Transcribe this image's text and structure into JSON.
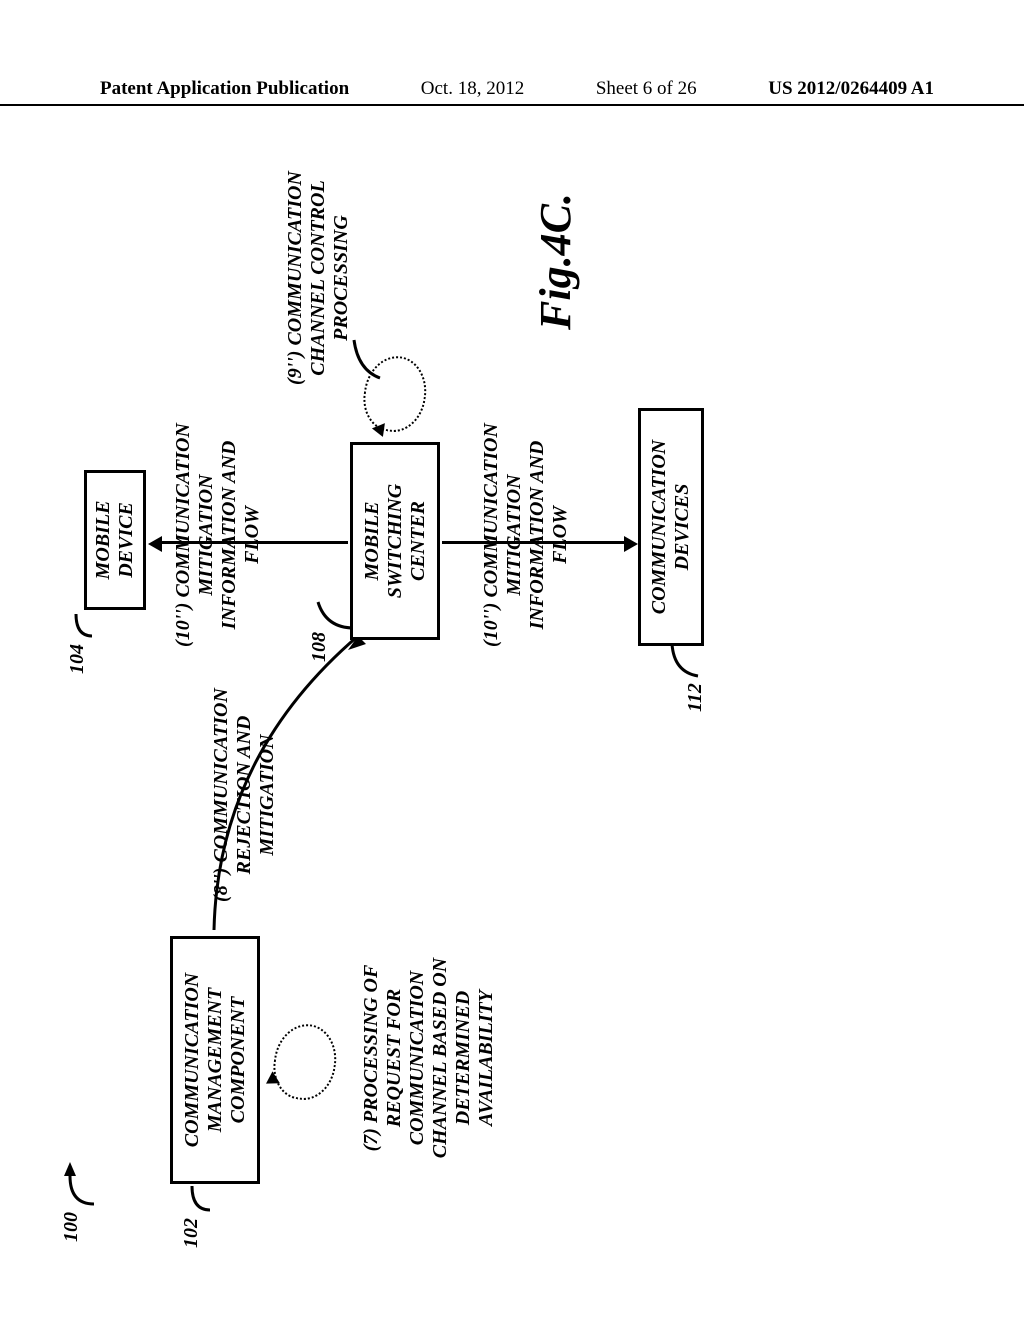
{
  "header": {
    "left": "Patent Application Publication",
    "mid_date": "Oct. 18, 2012",
    "mid_sheet": "Sheet 6 of 26",
    "right": "US 2012/0264409 A1"
  },
  "refs": {
    "r100": "100",
    "r102": "102",
    "r104": "104",
    "r108": "108",
    "r112": "112"
  },
  "boxes": {
    "cmc": "COMMUNICATION\nMANAGEMENT\nCOMPONENT",
    "mobile_device": "MOBILE\nDEVICE",
    "msc": "MOBILE\nSWITCHING\nCENTER",
    "comm_devices": "COMMUNICATION\nDEVICES"
  },
  "labels": {
    "step7": "(7) PROCESSING OF\nREQUEST FOR\nCOMMUNICATION\nCHANNEL BASED ON\nDETERMINED\nAVAILABILITY",
    "step8": "(8'') COMMUNICATION\nREJECTION AND\nMITIGATION",
    "step9": "(9'') COMMUNICATION\nCHANNEL CONTROL\nPROCESSING",
    "step10a": "(10'') COMMUNICATION\nMITIGATION\nINFORMATION AND\nFLOW",
    "step10b": "(10'') COMMUNICATION\nMITIGATION\nINFORMATION AND\nFLOW"
  },
  "figure_number": "Fig.4C."
}
